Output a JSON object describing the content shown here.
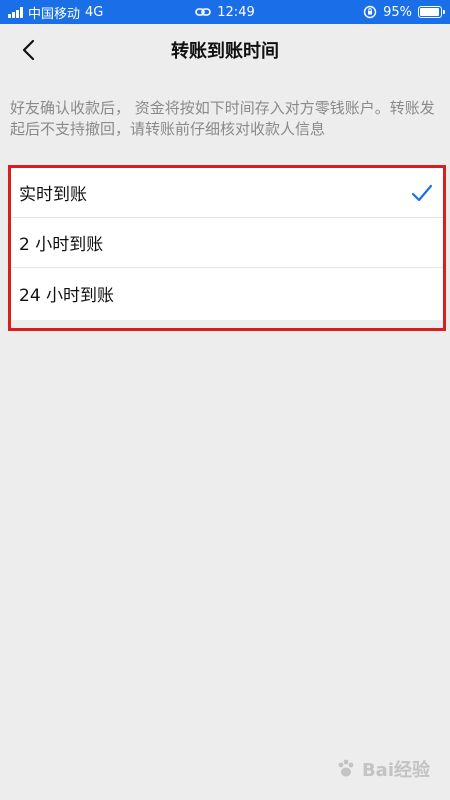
{
  "status_bar": {
    "carrier": "中国移动",
    "network": "4G",
    "time": "12:49",
    "battery": "95%",
    "battery_level": 0.95
  },
  "header": {
    "title": "转账到账时间",
    "back_icon": "chevron-left-icon"
  },
  "notice": {
    "text": "好友确认收款后， 资金将按如下时间存入对方零钱账户。转账发起后不支持撤回，请转账前仔细核对收款人信息"
  },
  "options": {
    "items": [
      {
        "label": "实时到账",
        "selected": true
      },
      {
        "label": "2 小时到账",
        "selected": false
      },
      {
        "label": "24 小时到账",
        "selected": false
      }
    ],
    "check_color": "#1a6fe8",
    "highlight_color": "#d81e1e"
  },
  "watermark": {
    "text": "Bai经验"
  }
}
